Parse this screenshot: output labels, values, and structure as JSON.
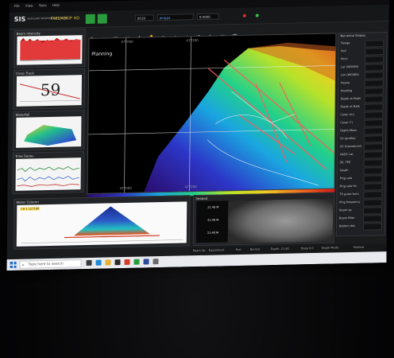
{
  "app": {
    "logo": "SIS",
    "logo_sub": "SEAFLOOR INFORMATION SYSTEM",
    "vessel_selector": "FAEDASKIP HD",
    "menu": [
      "File",
      "View",
      "Tools",
      "Help"
    ]
  },
  "toolbar": {
    "line_number": "0019",
    "mode": "pingpa",
    "value": "0.0000"
  },
  "panels": {
    "backscatter_title": "Beam Intensity",
    "cross_track_title": "Cross Track",
    "cross_track_value": "59",
    "waterfall_title": "Waterfall",
    "time_series_title": "Time Series",
    "water_column_title": "Water Column",
    "water_column_tag": "CH 1 123188",
    "sonar_title": "Seabed",
    "map_label": "Planning",
    "sonar_depth_labels": [
      "21.48 M",
      "21.48 M",
      "21.48 M"
    ],
    "map_coords_top": [
      "477000",
      "477200"
    ],
    "map_coords_bottom": [
      "477000",
      "477200"
    ]
  },
  "right_panel": {
    "title": "Numerical Display",
    "rows": [
      "Range",
      "Roll",
      "Pitch",
      "Lat (WGS84)",
      "Lon (WGS84)",
      "Heave",
      "Heading",
      "Depth at Nadir",
      "Depth at Bath",
      "Cover (m)",
      "Cover (°)",
      "Depth Mean",
      "SV (profile)",
      "SV (transducer)",
      "HADC Lat",
      "ZK, TPE",
      "Swath",
      "Ping rate",
      "Ping rate Hz",
      "TX pulse form",
      "Ping frequency",
      "Beam sp.",
      "Beam filter",
      "Bottom det."
    ]
  },
  "statusbar": {
    "items": [
      "Beam Sp. ",
      "Equidistant",
      "Port",
      "Normal",
      "Depth: 21.48",
      "Deep 0.0",
      "Depth Mode: ",
      "Shallow"
    ]
  },
  "taskbar": {
    "search_placeholder": "Type here to search",
    "time": "",
    "date": ""
  },
  "colors": {
    "accent_green": "#2b9a3c",
    "scale": [
      "#2b0b6a",
      "#2c36c8",
      "#1aa6e0",
      "#22d08a",
      "#b6e22a",
      "#f0d020",
      "#f07020",
      "#d21818"
    ]
  }
}
